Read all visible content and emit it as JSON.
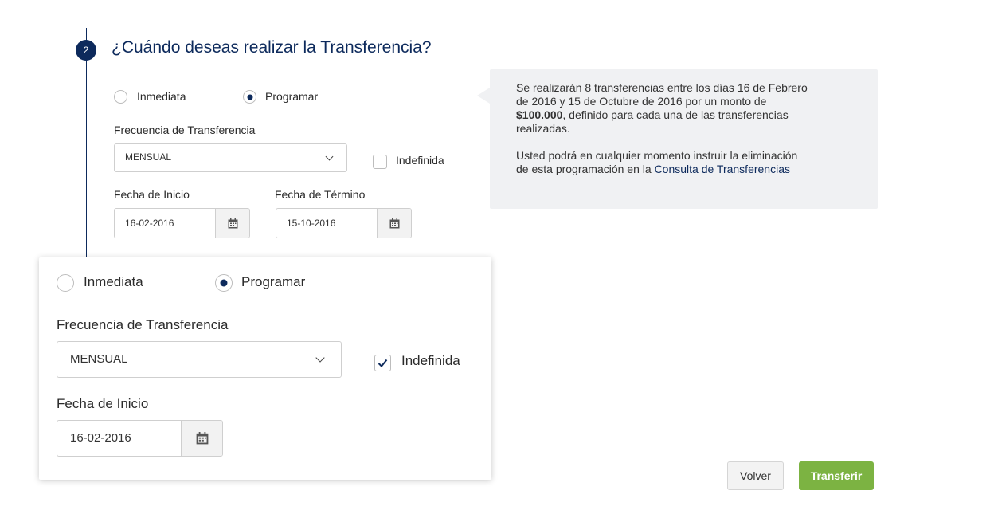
{
  "step": {
    "number": "2",
    "title": "¿Cuándo deseas realizar la Transferencia?"
  },
  "form": {
    "radio_immediate": "Inmediata",
    "radio_schedule": "Programar",
    "frequency_label": "Frecuencia de Transferencia",
    "frequency_value": "MENSUAL",
    "indefinite_label": "Indefinida",
    "indefinite_checked": false,
    "start_label": "Fecha de Inicio",
    "start_value": "16-02-2016",
    "end_label": "Fecha de Término",
    "end_value": "15-10-2016"
  },
  "info": {
    "line1": "Se realizarán 8 transferencias entre los días 16 de Febrero",
    "line2": "de 2016 y 15 de Octubre de 2016 por un monto de",
    "amount": "$100.000",
    "line3_rest": ", definido para cada una de las transferencias",
    "line4": "realizadas.",
    "line5": "Usted podrá en cualquier momento instruir la eliminación",
    "line6_prefix": "de esta programación en la ",
    "link": "Consulta de Transferencias"
  },
  "zoom_detail": {
    "radio_immediate": "Inmediata",
    "radio_schedule": "Programar",
    "frequency_label": "Frecuencia de Transferencia",
    "frequency_value": "MENSUAL",
    "indefinite_label": "Indefinida",
    "indefinite_checked": true,
    "start_label": "Fecha de Inicio",
    "start_value": "16-02-2016"
  },
  "actions": {
    "back": "Volver",
    "submit": "Transferir"
  },
  "colors": {
    "primary": "#0d2a5c",
    "submit": "#7cb342",
    "info_bg": "#f0f1f3"
  },
  "icons": [
    "calendar-icon",
    "chevron-down-icon",
    "checkmark-icon"
  ]
}
